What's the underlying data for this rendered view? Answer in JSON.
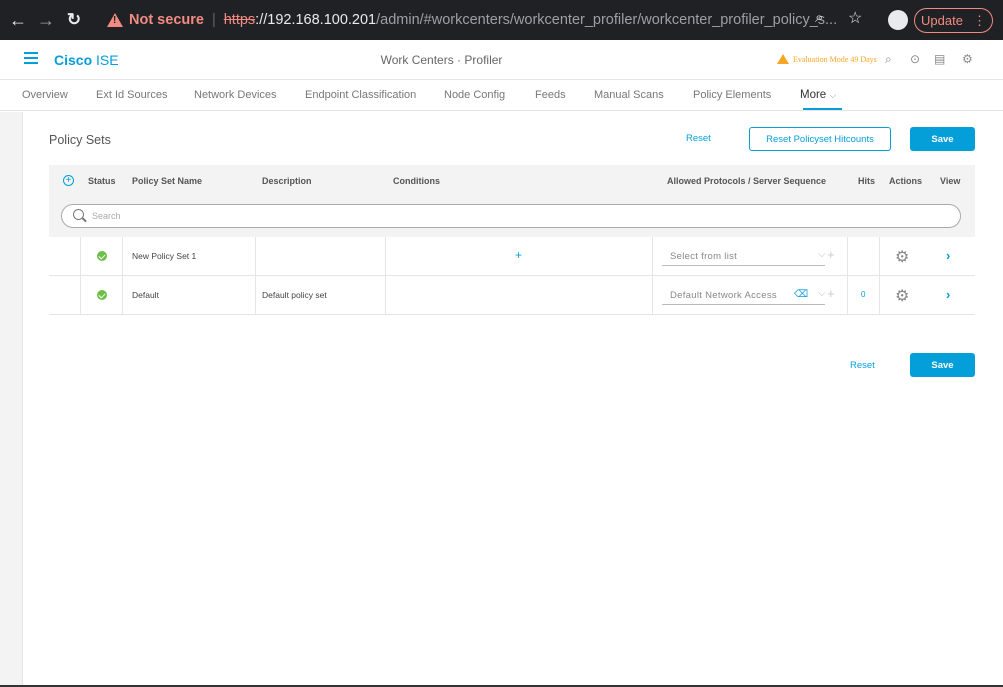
{
  "browser": {
    "not_secure": "Not secure",
    "url_scheme": "https",
    "url_host": "://192.168.100.201",
    "url_path": "/admin/#workcenters/workcenter_profiler/workcenter_profiler_policy_s...",
    "update_label": "Update"
  },
  "header": {
    "brand_bold": "Cisco",
    "brand_rest": " ISE",
    "title": "Work Centers · Profiler",
    "eval_mode": "Evaluation Mode 49 Days"
  },
  "tabs": [
    {
      "label": "Overview"
    },
    {
      "label": "Ext Id Sources"
    },
    {
      "label": "Network Devices"
    },
    {
      "label": "Endpoint Classification"
    },
    {
      "label": "Node Config"
    },
    {
      "label": "Feeds"
    },
    {
      "label": "Manual Scans"
    },
    {
      "label": "Policy Elements"
    },
    {
      "label": "More"
    }
  ],
  "page": {
    "title": "Policy Sets",
    "reset_label": "Reset",
    "reset_hitcounts_label": "Reset Policyset Hitcounts",
    "save_label": "Save"
  },
  "table": {
    "columns": {
      "status": "Status",
      "name": "Policy Set Name",
      "description": "Description",
      "conditions": "Conditions",
      "protocols": "Allowed Protocols / Server Sequence",
      "hits": "Hits",
      "actions": "Actions",
      "view": "View"
    },
    "search_placeholder": "Search",
    "rows": [
      {
        "name": "New Policy Set 1",
        "description": "",
        "protocol": "Select from list",
        "hits": ""
      },
      {
        "name": "Default",
        "description": "Default policy set",
        "protocol": "Default Network Access",
        "hits": "0"
      }
    ]
  },
  "footer": {
    "reset_label": "Reset",
    "save_label": "Save"
  }
}
